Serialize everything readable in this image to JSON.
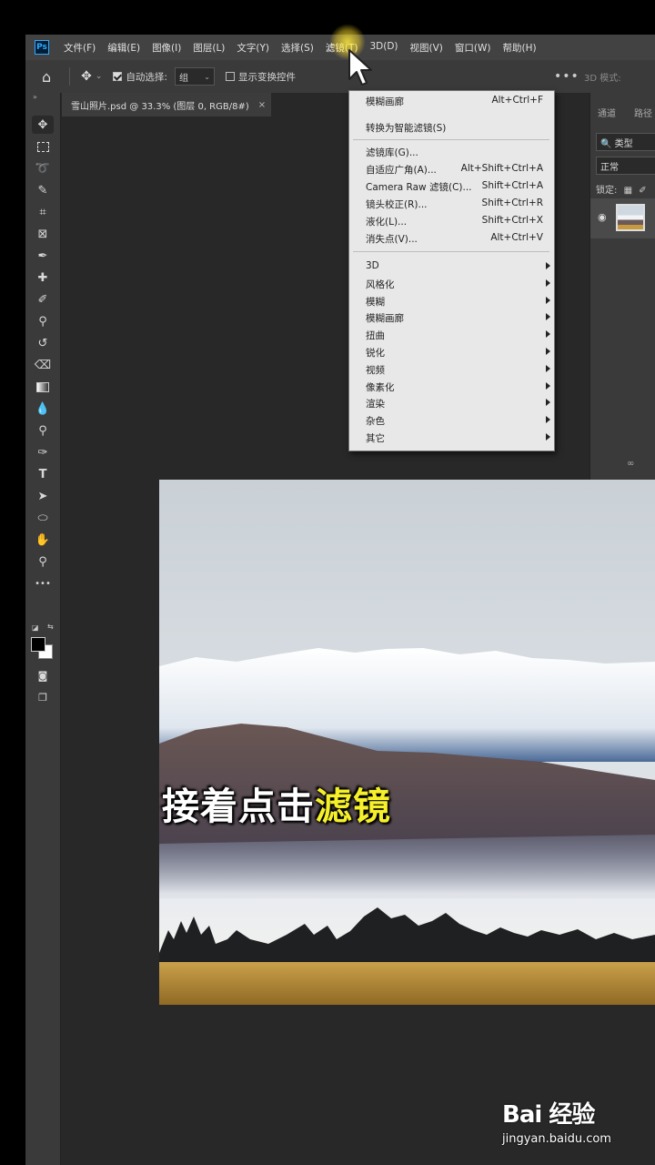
{
  "menubar": {
    "logo": "Ps",
    "items": [
      {
        "label": "文件(F)"
      },
      {
        "label": "编辑(E)"
      },
      {
        "label": "图像(I)"
      },
      {
        "label": "图层(L)"
      },
      {
        "label": "文字(Y)"
      },
      {
        "label": "选择(S)"
      },
      {
        "label": "滤镜(T)",
        "active": true
      },
      {
        "label": "3D(D)"
      },
      {
        "label": "视图(V)"
      },
      {
        "label": "窗口(W)"
      },
      {
        "label": "帮助(H)"
      }
    ]
  },
  "options_bar": {
    "auto_select_label": "自动选择:",
    "auto_select_checked": true,
    "auto_select_value": "组",
    "show_transform_label": "显示变换控件",
    "show_transform_checked": false,
    "more": "•••",
    "mode_3d": "3D 模式:"
  },
  "document_tab": {
    "title": "雪山照片.psd @ 33.3% (图层 0, RGB/8#)",
    "close": "×"
  },
  "filter_menu": {
    "section1": [
      {
        "label": "模糊画廊",
        "shortcut": "Alt+Ctrl+F"
      },
      {
        "label": "转换为智能滤镜(S)",
        "shortcut": ""
      }
    ],
    "section2": [
      {
        "label": "滤镜库(G)...",
        "shortcut": ""
      },
      {
        "label": "自适应广角(A)...",
        "shortcut": "Alt+Shift+Ctrl+A"
      },
      {
        "label": "Camera Raw 滤镜(C)...",
        "shortcut": "Shift+Ctrl+A"
      },
      {
        "label": "镜头校正(R)...",
        "shortcut": "Shift+Ctrl+R"
      },
      {
        "label": "液化(L)...",
        "shortcut": "Shift+Ctrl+X"
      },
      {
        "label": "消失点(V)...",
        "shortcut": "Alt+Ctrl+V"
      }
    ],
    "section3": [
      {
        "label": "3D"
      },
      {
        "label": "风格化"
      },
      {
        "label": "模糊"
      },
      {
        "label": "模糊画廊"
      },
      {
        "label": "扭曲"
      },
      {
        "label": "锐化"
      },
      {
        "label": "视频"
      },
      {
        "label": "像素化"
      },
      {
        "label": "渲染"
      },
      {
        "label": "杂色"
      },
      {
        "label": "其它"
      }
    ]
  },
  "layers_panel": {
    "tab_channels": "通道",
    "tab_paths": "路径",
    "kind_filter": "🔍 类型",
    "blend_mode": "正常",
    "lock_label": "锁定:",
    "link_icon_text": "∞"
  },
  "caption": {
    "main": "接着点击",
    "highlight": "滤镜"
  },
  "watermark": {
    "brand": "Bai 经验",
    "url": "jingyan.baidu.com"
  },
  "colors": {
    "app_bg": "#282828",
    "panel_bg": "#3a3a3a",
    "menu_bg": "#e8e8e8",
    "caption_highlight": "#f5f02a",
    "ps_blue": "#31a8ff"
  }
}
